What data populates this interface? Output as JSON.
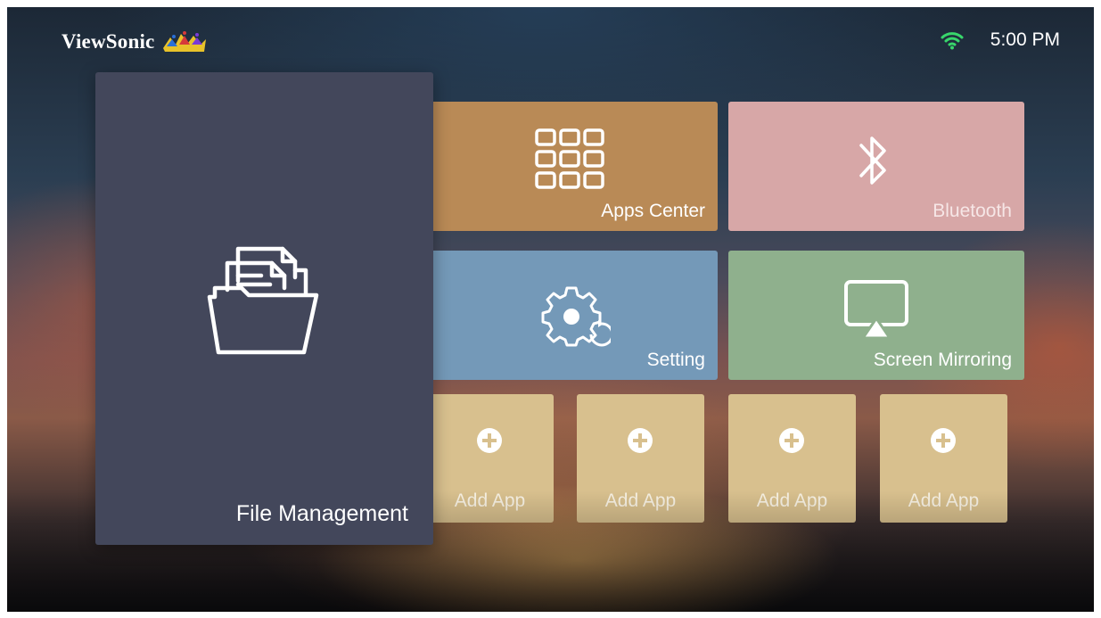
{
  "header": {
    "brand": "ViewSonic",
    "logo_icon": "viewsonic-birds-logo",
    "wifi_icon": "wifi-icon",
    "time": "5:00 PM"
  },
  "tiles": {
    "file_management": {
      "label": "File Management",
      "icon": "folder-documents-icon",
      "color": "#43475b"
    },
    "apps_center": {
      "label": "Apps Center",
      "icon": "apps-grid-icon",
      "color": "#b98a56"
    },
    "bluetooth": {
      "label": "Bluetooth",
      "icon": "bluetooth-icon",
      "color": "#d7a7a7"
    },
    "setting": {
      "label": "Setting",
      "icon": "gear-icon",
      "color": "#7499b8"
    },
    "screen_mirroring": {
      "label": "Screen Mirroring",
      "icon": "screen-mirroring-icon",
      "color": "#8fb08d"
    },
    "add_apps": [
      {
        "label": "Add App",
        "icon": "plus-circle-icon"
      },
      {
        "label": "Add App",
        "icon": "plus-circle-icon"
      },
      {
        "label": "Add App",
        "icon": "plus-circle-icon"
      },
      {
        "label": "Add App",
        "icon": "plus-circle-icon"
      }
    ],
    "add_app_color": "#d8c08e"
  },
  "colors": {
    "wifi": "#38d66b",
    "text": "#ffffff"
  }
}
